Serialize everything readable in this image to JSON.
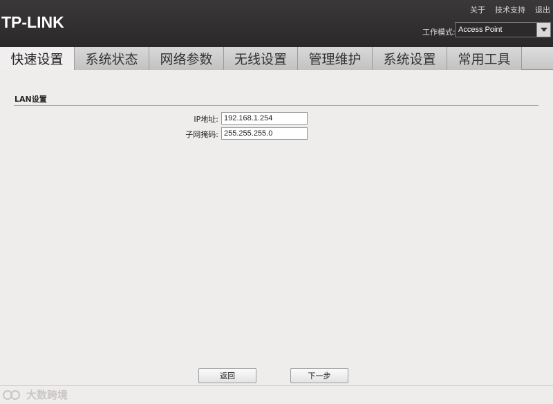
{
  "header": {
    "logo": "TP-LINK",
    "links": [
      "关于",
      "技术支持",
      "退出"
    ],
    "mode_label": "工作模式:",
    "mode_value": "Access Point"
  },
  "tabs": [
    {
      "label": "快速设置",
      "active": true
    },
    {
      "label": "系统状态",
      "active": false
    },
    {
      "label": "网络参数",
      "active": false
    },
    {
      "label": "无线设置",
      "active": false
    },
    {
      "label": "管理维护",
      "active": false
    },
    {
      "label": "系统设置",
      "active": false
    },
    {
      "label": "常用工具",
      "active": false
    }
  ],
  "section": {
    "title": "LAN设置"
  },
  "form": {
    "ip_label": "IP地址:",
    "ip_value": "192.168.1.254",
    "mask_label": "子网掩码:",
    "mask_value": "255.255.255.0"
  },
  "buttons": {
    "back": "返回",
    "next": "下一步"
  },
  "watermark": {
    "text": "大数跨境"
  },
  "colors": {
    "header_bg": "#2a2828",
    "page_bg": "#efedec"
  }
}
